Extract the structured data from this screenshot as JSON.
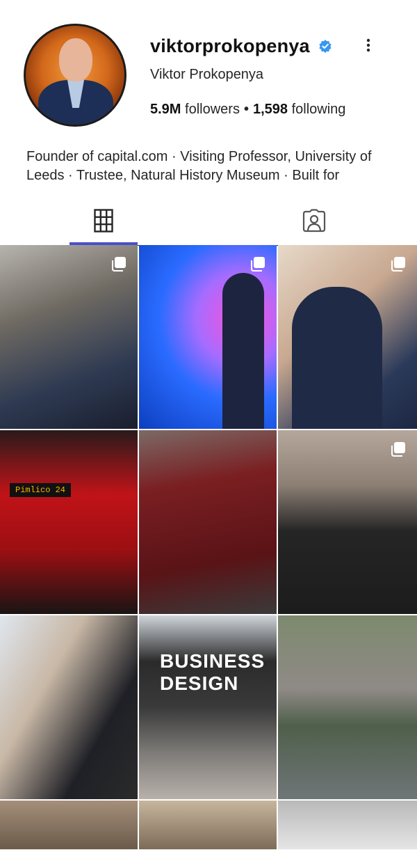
{
  "profile": {
    "username": "viktorprokopenya",
    "full_name": "Viktor Prokopenya",
    "followers_count": "5.9M",
    "followers_label": "followers",
    "following_count": "1,598",
    "following_label": "following",
    "bio": "Founder of capital.com · Visiting Professor, University of Leeds · Trustee, Natural History Museum · Built for",
    "verified_color": "#3897f0"
  },
  "tabs": [
    {
      "name": "posts-grid",
      "icon": "grid-icon",
      "active": true
    },
    {
      "name": "tagged",
      "icon": "tagged-person-icon",
      "active": false
    }
  ],
  "posts": [
    {
      "multi": true
    },
    {
      "multi": true
    },
    {
      "multi": true
    },
    {
      "multi": false,
      "sign_text": "Pimlico 24"
    },
    {
      "multi": false
    },
    {
      "multi": true
    },
    {
      "multi": false
    },
    {
      "multi": false,
      "sign_text": "BUSINESS DESIGN"
    },
    {
      "multi": false
    },
    {
      "multi": false
    },
    {
      "multi": false
    },
    {
      "multi": false
    }
  ],
  "colors": {
    "accent": "#4a4ec9",
    "text": "#262626"
  }
}
